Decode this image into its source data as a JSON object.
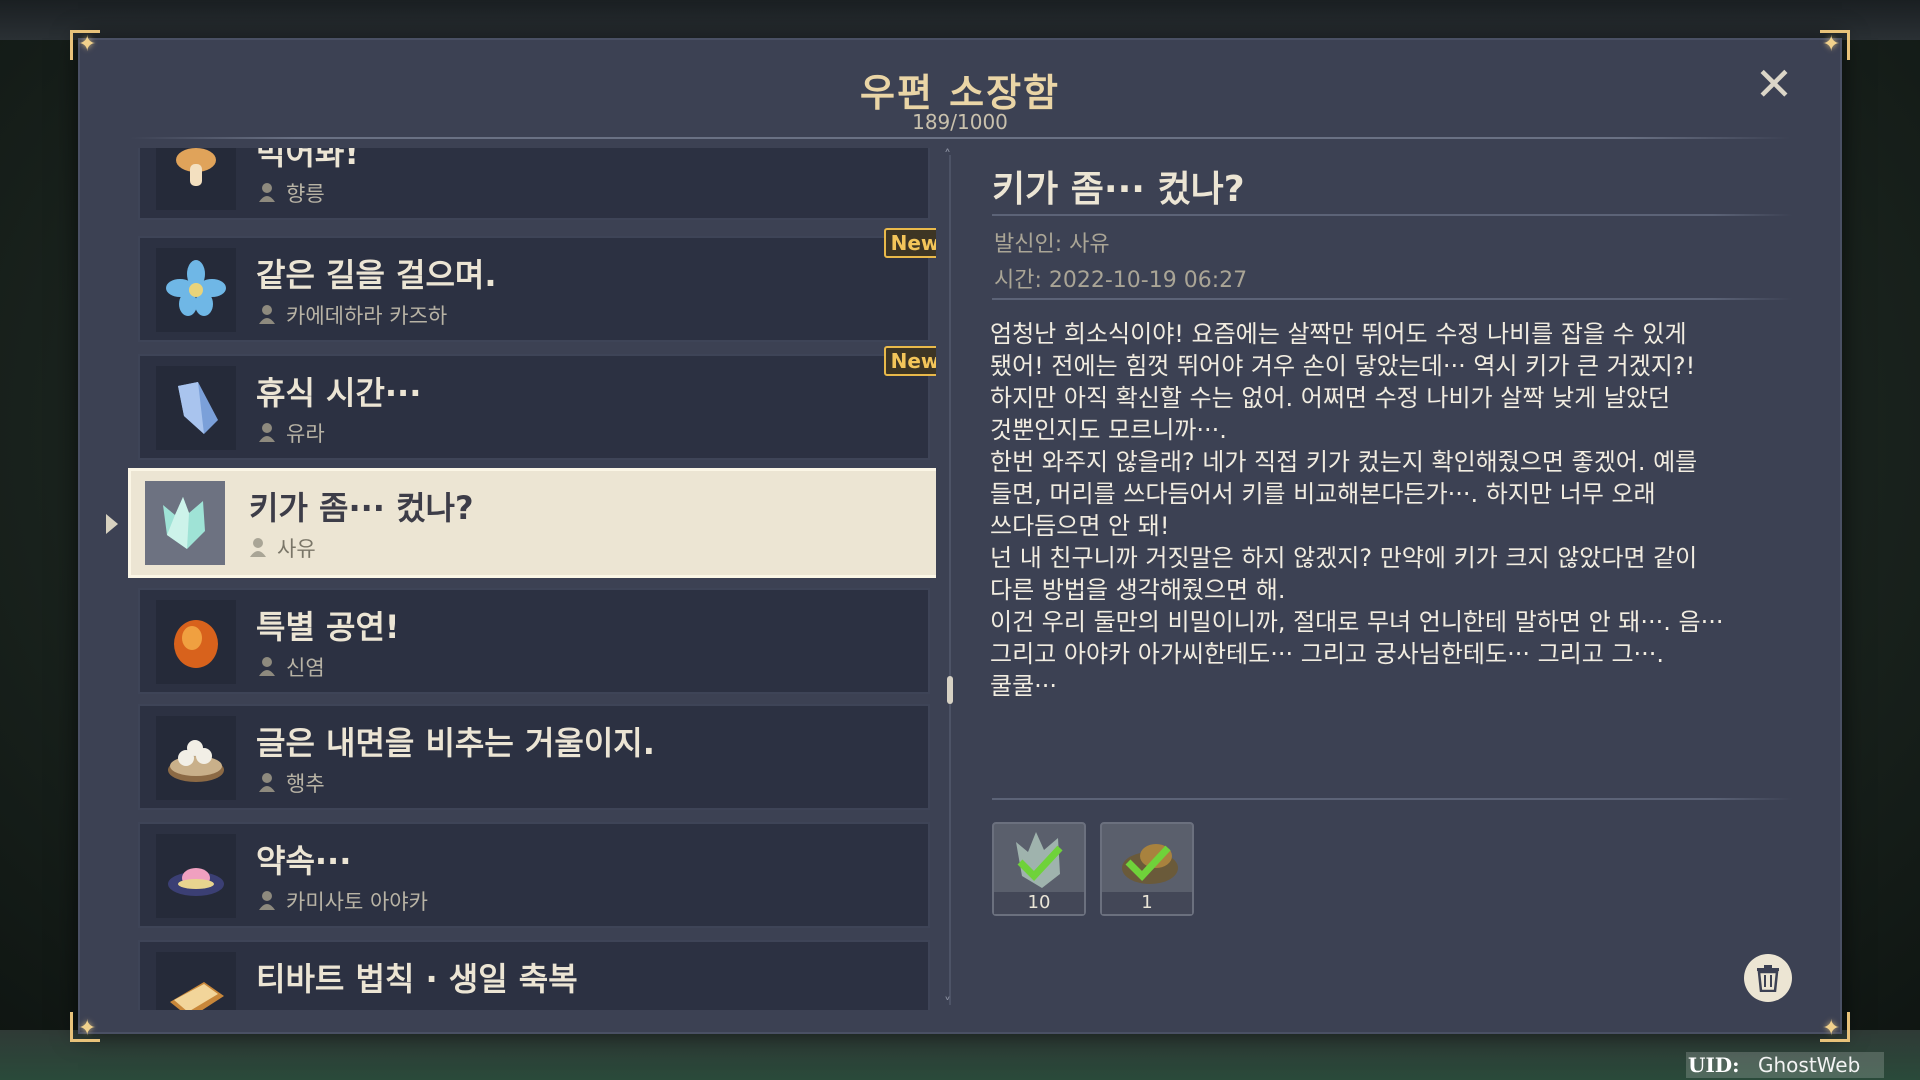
{
  "mailbox": {
    "title": "우편 소장함",
    "count": "189/1000",
    "close_icon": "close-icon"
  },
  "mail_list": [
    {
      "subject": "먹어봐!",
      "sender": "향릉",
      "icon": "mushroom-icon",
      "new": false,
      "selected": false
    },
    {
      "subject": "같은 길을 걸으며.",
      "sender": "카에데하라 카즈하",
      "icon": "flower-icon",
      "new": true,
      "selected": false
    },
    {
      "subject": "휴식 시간···",
      "sender": "유라",
      "icon": "crystal-icon",
      "new": true,
      "selected": false
    },
    {
      "subject": "키가 좀··· 컸나?",
      "sender": "사유",
      "icon": "crystal-chunk-icon",
      "new": false,
      "selected": true
    },
    {
      "subject": "특별 공연!",
      "sender": "신염",
      "icon": "amber-stone-icon",
      "new": false,
      "selected": false
    },
    {
      "subject": "글은 내면을 비추는 거울이지.",
      "sender": "행추",
      "icon": "dumpling-tray-icon",
      "new": false,
      "selected": false
    },
    {
      "subject": "약속···",
      "sender": "카미사토 아야카",
      "icon": "dessert-plate-icon",
      "new": false,
      "selected": false
    },
    {
      "subject": "티바트 법칙 · 생일 축복",
      "sender": "",
      "icon": "scroll-icon",
      "new": false,
      "selected": false
    }
  ],
  "new_label": "New",
  "detail": {
    "title": "키가 좀··· 컸나?",
    "sender_line": "발신인: 사유",
    "time_line": "시간: 2022-10-19 06:27",
    "body": "엄청난 희소식이야! 요즘에는 살짝만 뛰어도 수정 나비를 잡을 수 있게\n됐어! 전에는 힘껏 뛰어야 겨우 손이 닿았는데··· 역시 키가 큰 거겠지?!\n하지만 아직 확신할 수는 없어. 어쩌면 수정 나비가 살짝 낮게 날았던\n것뿐인지도 모르니까···.\n한번 와주지 않을래? 네가 직접 키가 컸는지 확인해줬으면 좋겠어. 예를\n들면, 머리를 쓰다듬어서 키를 비교해본다든가···. 하지만 너무 오래\n쓰다듬으면 안 돼!\n넌 내 친구니까 거짓말은 하지 않겠지? 만약에 키가 크지 않았다면 같이\n다른 방법을 생각해줬으면 해.\n이건 우리 둘만의 비밀이니까, 절대로 무녀 언니한테 말하면 안 돼···. 음···\n그리고 아야카 아가씨한테도··· 그리고 궁사님한테도··· 그리고 그···.\n쿨쿨···",
    "attachments": [
      {
        "icon": "crystal-chunk-icon",
        "qty": "10",
        "claimed": true
      },
      {
        "icon": "meal-icon",
        "qty": "1",
        "claimed": true
      }
    ],
    "delete_icon": "trash-icon"
  },
  "uid": {
    "label": "UID:",
    "value": "GhostWeb"
  },
  "colors": {
    "panel": "#3c4153",
    "item": "#2c3142",
    "selected": "#ece5d3",
    "accent_gold": "#e9b94a",
    "title": "#ead5a6"
  }
}
